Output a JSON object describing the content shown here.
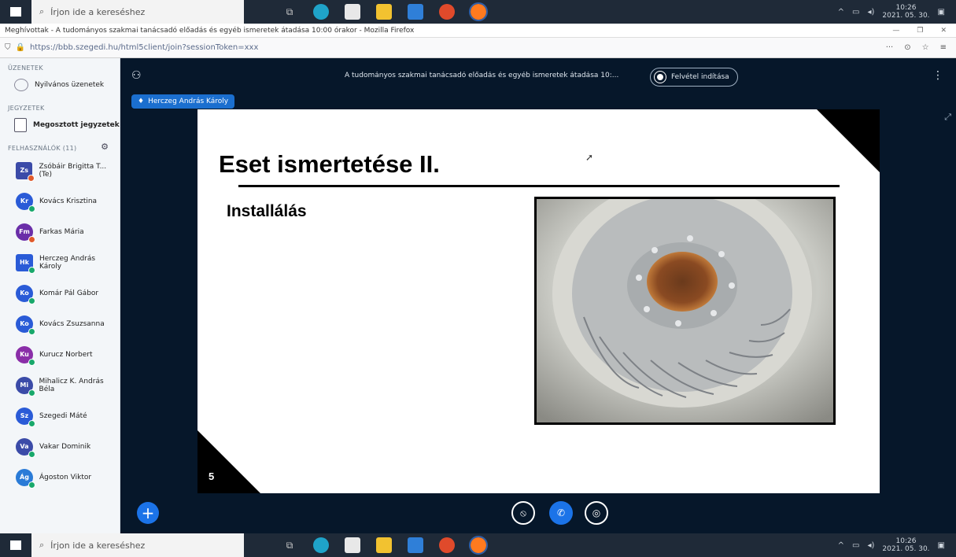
{
  "taskbar": {
    "search_placeholder": "Írjon ide a kereséshez",
    "clock_time": "10:26",
    "clock_date": "2021. 05. 30."
  },
  "browser": {
    "title": "Meghívottak - A tudományos szakmai tanácsadó előadás és egyéb ismeretek átadása 10:00 órakor - Mozilla Firefox",
    "url": "https://bbb.szegedi.hu/html5client/join?sessionToken=xxx"
  },
  "sidebar": {
    "messages_heading": "ÜZENETEK",
    "public_chat": "Nyilvános üzenetek",
    "notes_heading": "JEGYZETEK",
    "shared_notes": "Megosztott jegyzetek",
    "users_heading": "FELHASZNÁLÓK (11)",
    "users": [
      {
        "initials": "Zs",
        "name": "Zsóbáir Brigitta T...  (Te)",
        "color": "#3b4ba8",
        "square": true,
        "dot": "#e05a2b"
      },
      {
        "initials": "Kr",
        "name": "Kovács Krisztina",
        "color": "#2a5bd7",
        "square": false,
        "dot": "#18a86b"
      },
      {
        "initials": "Fm",
        "name": "Farkas Mária",
        "color": "#6a2ea8",
        "square": false,
        "dot": "#e05a2b"
      },
      {
        "initials": "Hk",
        "name": "Herczeg András Károly",
        "color": "#2a5bd7",
        "square": true,
        "dot": "#18a86b"
      },
      {
        "initials": "Ko",
        "name": "Komár Pál Gábor",
        "color": "#2a5bd7",
        "square": false,
        "dot": "#18a86b"
      },
      {
        "initials": "Ko",
        "name": "Kovács Zsuzsanna",
        "color": "#2a5bd7",
        "square": false,
        "dot": "#18a86b"
      },
      {
        "initials": "Ku",
        "name": "Kurucz Norbert",
        "color": "#8a2ea8",
        "square": false,
        "dot": "#18a86b"
      },
      {
        "initials": "Mi",
        "name": "Mihalicz K. András Béla",
        "color": "#3b4ba8",
        "square": false,
        "dot": "#18a86b"
      },
      {
        "initials": "Sz",
        "name": "Szegedi Máté",
        "color": "#2a5bd7",
        "square": false,
        "dot": "#18a86b"
      },
      {
        "initials": "Va",
        "name": "Vakar Dominik",
        "color": "#3b4ba8",
        "square": false,
        "dot": "#18a86b"
      },
      {
        "initials": "Ág",
        "name": "Ágoston Viktor",
        "color": "#2a7bd7",
        "square": false,
        "dot": "#18a86b"
      }
    ]
  },
  "meeting": {
    "title": "A tudományos szakmai tanácsadó előadás és egyéb ismeretek átadása 10:...",
    "recording_label": "Felvétel indítása",
    "presenter_name": "Herczeg András Károly"
  },
  "slide": {
    "title": "Eset ismertetése II.",
    "subtitle": "Installálás",
    "number": "5",
    "photo_description": "fan impeller"
  }
}
